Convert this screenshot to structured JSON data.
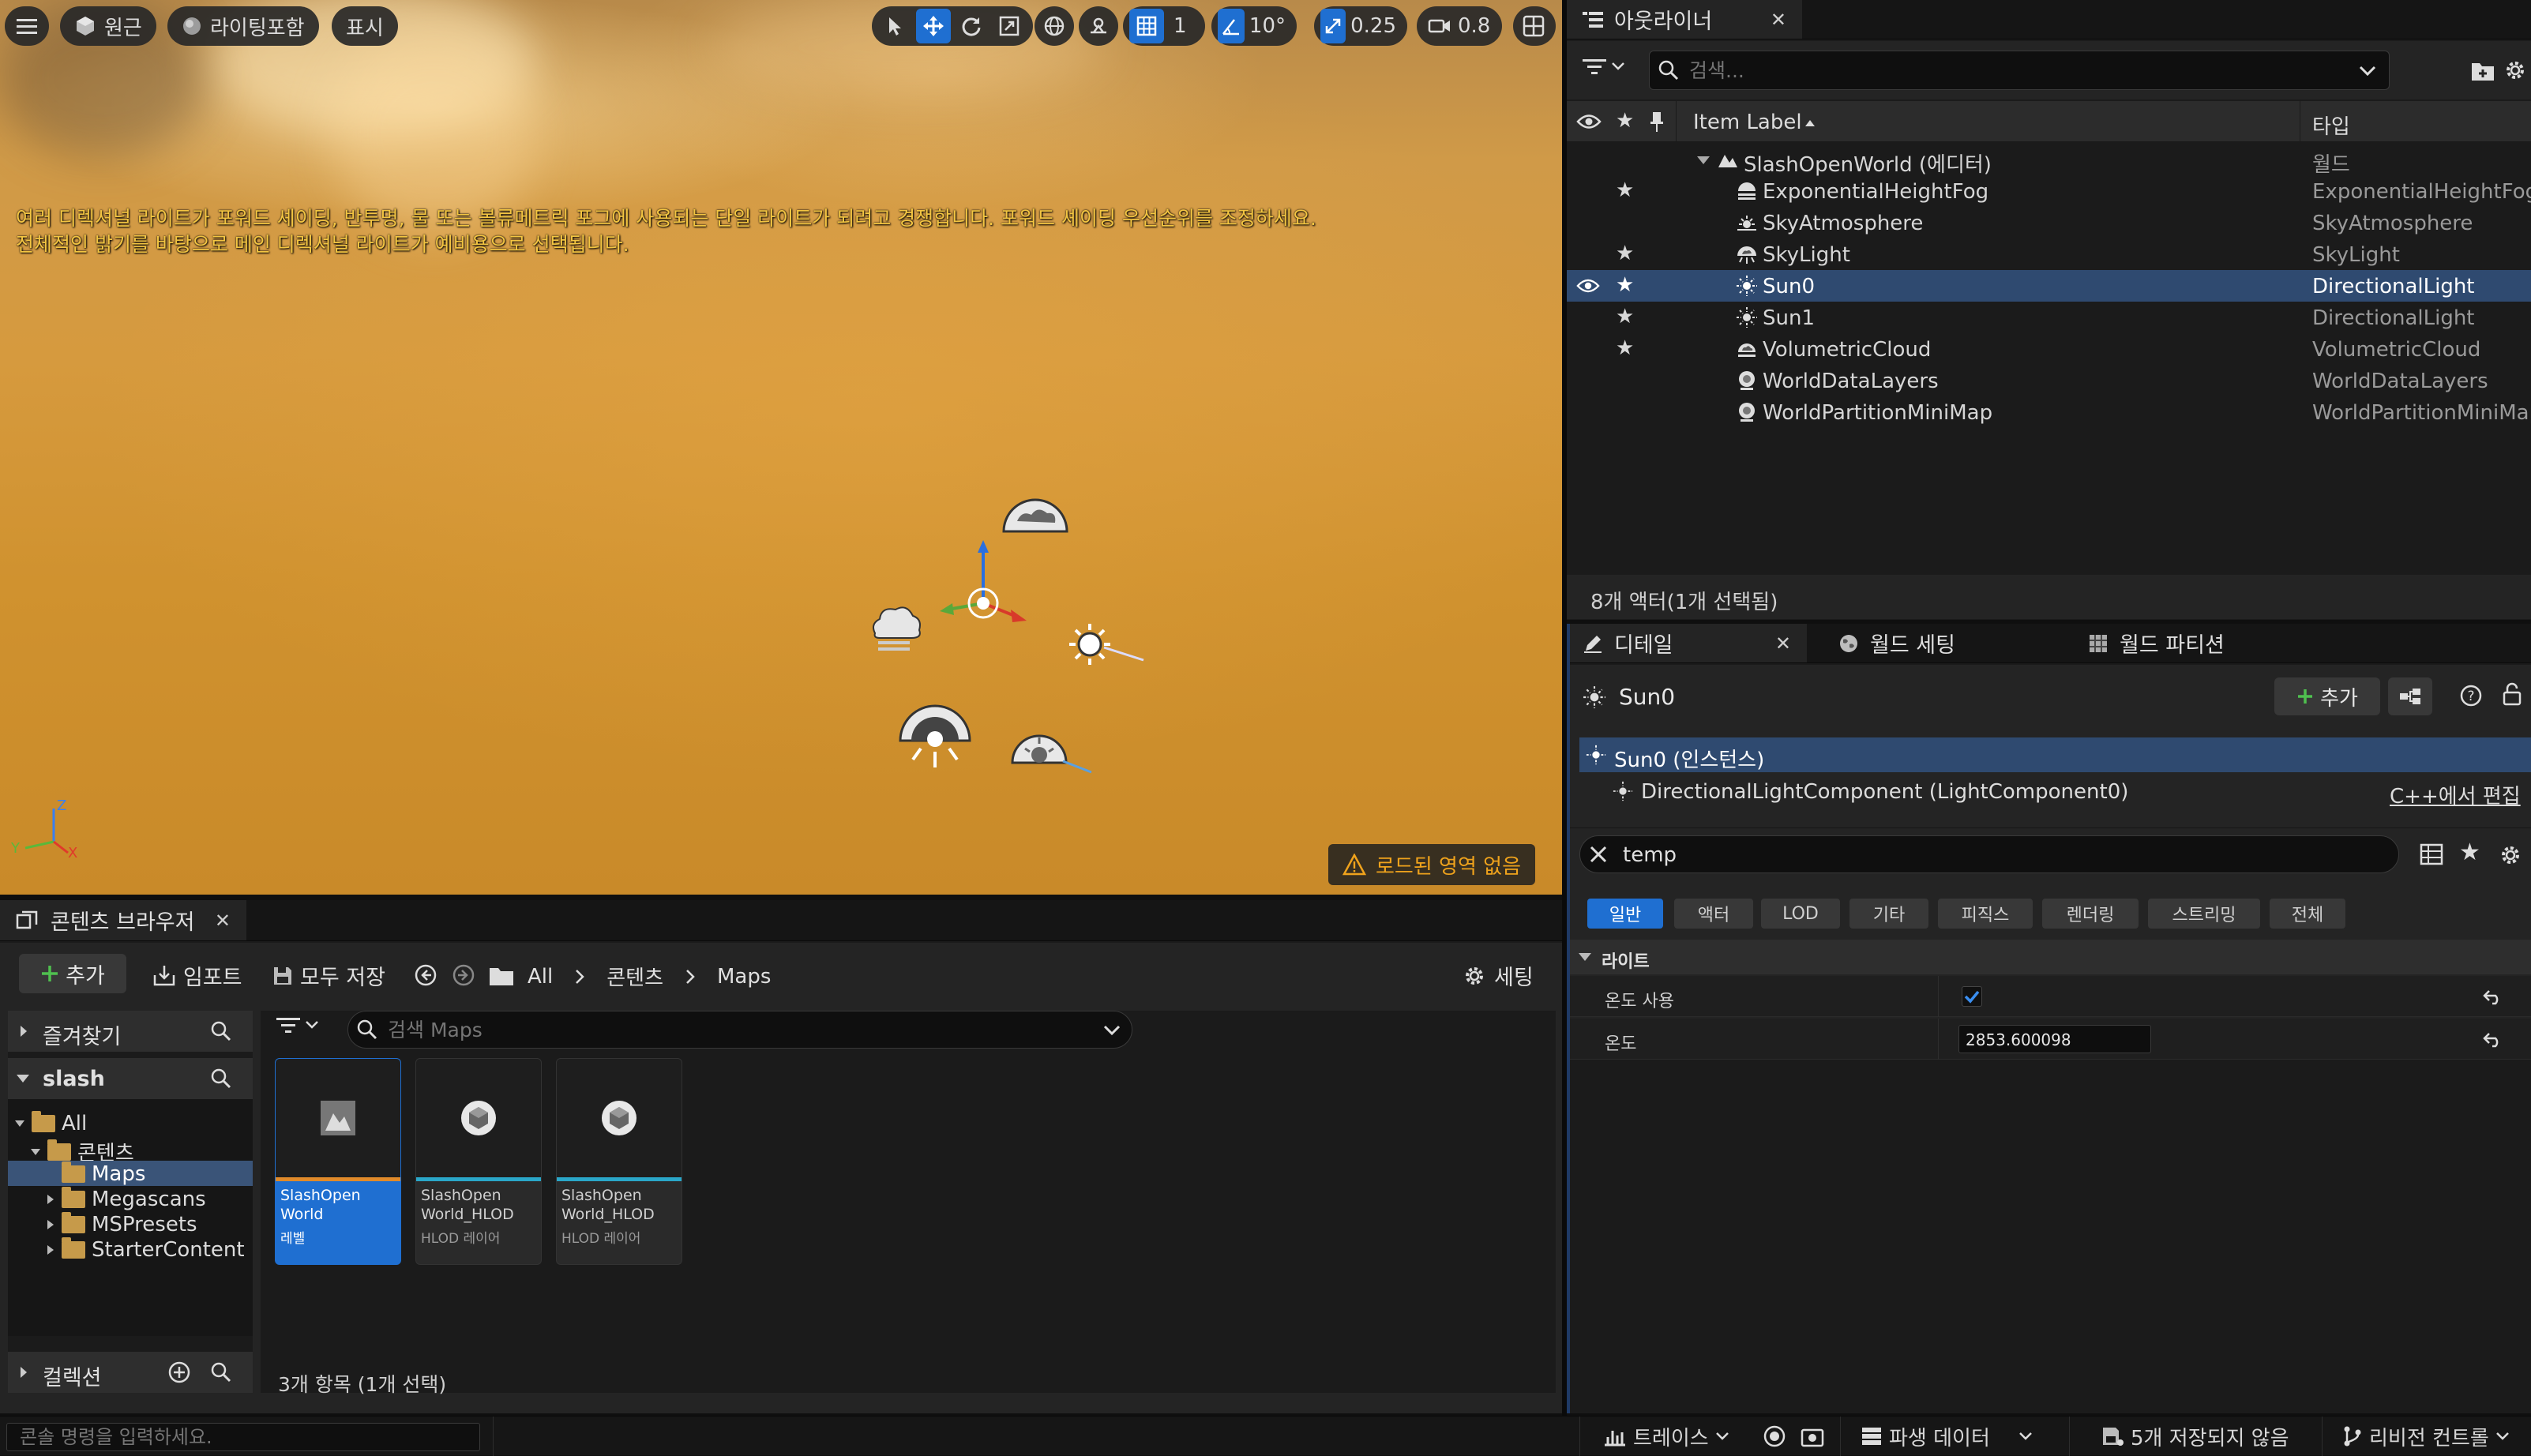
{
  "viewport": {
    "view_mode": "원근",
    "lighting_mode": "라이팅포함",
    "show_label": "표시",
    "grid_snap_value": "1",
    "rotation_snap_value": "10°",
    "scale_snap_value": "0.25",
    "camera_speed": "0.8",
    "warning_line1": "여러 디렉셔널 라이트가 포워드 셰이딩, 반투명, 물 또는 볼류메트릭 포그에 사용되는 단일 라이트가 되려고 경쟁합니다. 포워드 셰이딩 우선순위를 조정하세요.",
    "warning_line2": "전체적인 밝기를 바탕으로 메인 디렉셔널 라이트가 예비용으로 선택됩니다.",
    "no_region_label": "로드된 영역 없음",
    "axis_z": "Z",
    "axis_y": "Y",
    "axis_x": "X"
  },
  "outliner": {
    "tab_title": "아웃라이너",
    "search_placeholder": "검색...",
    "col_label": "Item Label",
    "col_type": "타입",
    "world": {
      "label": "SlashOpenWorld (에디터)",
      "type": "월드"
    },
    "items": [
      {
        "label": "ExponentialHeightFog",
        "type": "ExponentialHeightFog",
        "star": "★",
        "icon": "fog-icon"
      },
      {
        "label": "SkyAtmosphere",
        "type": "SkyAtmosphere",
        "star": "",
        "icon": "sky-atmosphere-icon"
      },
      {
        "label": "SkyLight",
        "type": "SkyLight",
        "star": "★",
        "icon": "skylight-icon"
      },
      {
        "label": "Sun0",
        "type": "DirectionalLight",
        "star": "★",
        "icon": "directional-light-icon"
      },
      {
        "label": "Sun1",
        "type": "DirectionalLight",
        "star": "★",
        "icon": "directional-light-icon"
      },
      {
        "label": "VolumetricCloud",
        "type": "VolumetricCloud",
        "star": "★",
        "icon": "cloud-icon"
      },
      {
        "label": "WorldDataLayers",
        "type": "WorldDataLayers",
        "star": "",
        "icon": "world-info-icon"
      },
      {
        "label": "WorldPartitionMiniMap",
        "type": "WorldPartitionMiniMap",
        "star": "",
        "icon": "world-info-icon"
      }
    ],
    "footer": "8개 액터(1개 선택됨)"
  },
  "details": {
    "tabs": [
      "디테일",
      "월드 세팅",
      "월드 파티션"
    ],
    "actor_name": "Sun0",
    "add_label": "추가",
    "instance_label": "Sun0 (인스턴스)",
    "component_label": "DirectionalLightComponent (LightComponent0)",
    "edit_cpp_label": "C++에서 편집",
    "filter_value": "temp",
    "categories": [
      "일반",
      "액터",
      "LOD",
      "기타",
      "피직스",
      "렌더링",
      "스트리밍",
      "전체"
    ],
    "section": "라이트",
    "use_temperature_label": "온도 사용",
    "use_temperature_checked": true,
    "temperature_label": "온도",
    "temperature_value": "2853.600098"
  },
  "content_browser": {
    "tab_title": "콘텐츠 브라우저",
    "add_label": "추가",
    "import_label": "임포트",
    "save_all_label": "모두 저장",
    "path": [
      "All",
      "콘텐츠",
      "Maps"
    ],
    "settings_label": "세팅",
    "favorites_label": "즐겨찾기",
    "project_label": "slash",
    "tree": [
      "All",
      "콘텐츠",
      "Maps",
      "Megascans",
      "MSPresets",
      "StarterContent"
    ],
    "collections_label": "컬렉션",
    "search_placeholder": "검색 Maps",
    "assets": [
      {
        "name": "SlashOpen World",
        "kind": "레벨",
        "bar_color": "#e08a2a"
      },
      {
        "name": "SlashOpen World_HLOD",
        "kind": "HLOD 레이어",
        "bar_color": "#2aa7c9"
      },
      {
        "name": "SlashOpen World_HLOD",
        "kind": "HLOD 레이어",
        "bar_color": "#2aa7c9"
      }
    ],
    "status": "3개 항목 (1개 선택)"
  },
  "statusbar": {
    "console_placeholder": "콘솔 명령을 입력하세요.",
    "trace_label": "트레이스",
    "derived_data_label": "파생 데이터",
    "unsaved_label": "5개 저장되지 않음",
    "revision_label": "리비전 컨트롤"
  },
  "colors": {
    "accent": "#1f6fd1",
    "selected_row": "#2f4a70",
    "warning": "#f3c542",
    "folder": "#c69a4a"
  }
}
